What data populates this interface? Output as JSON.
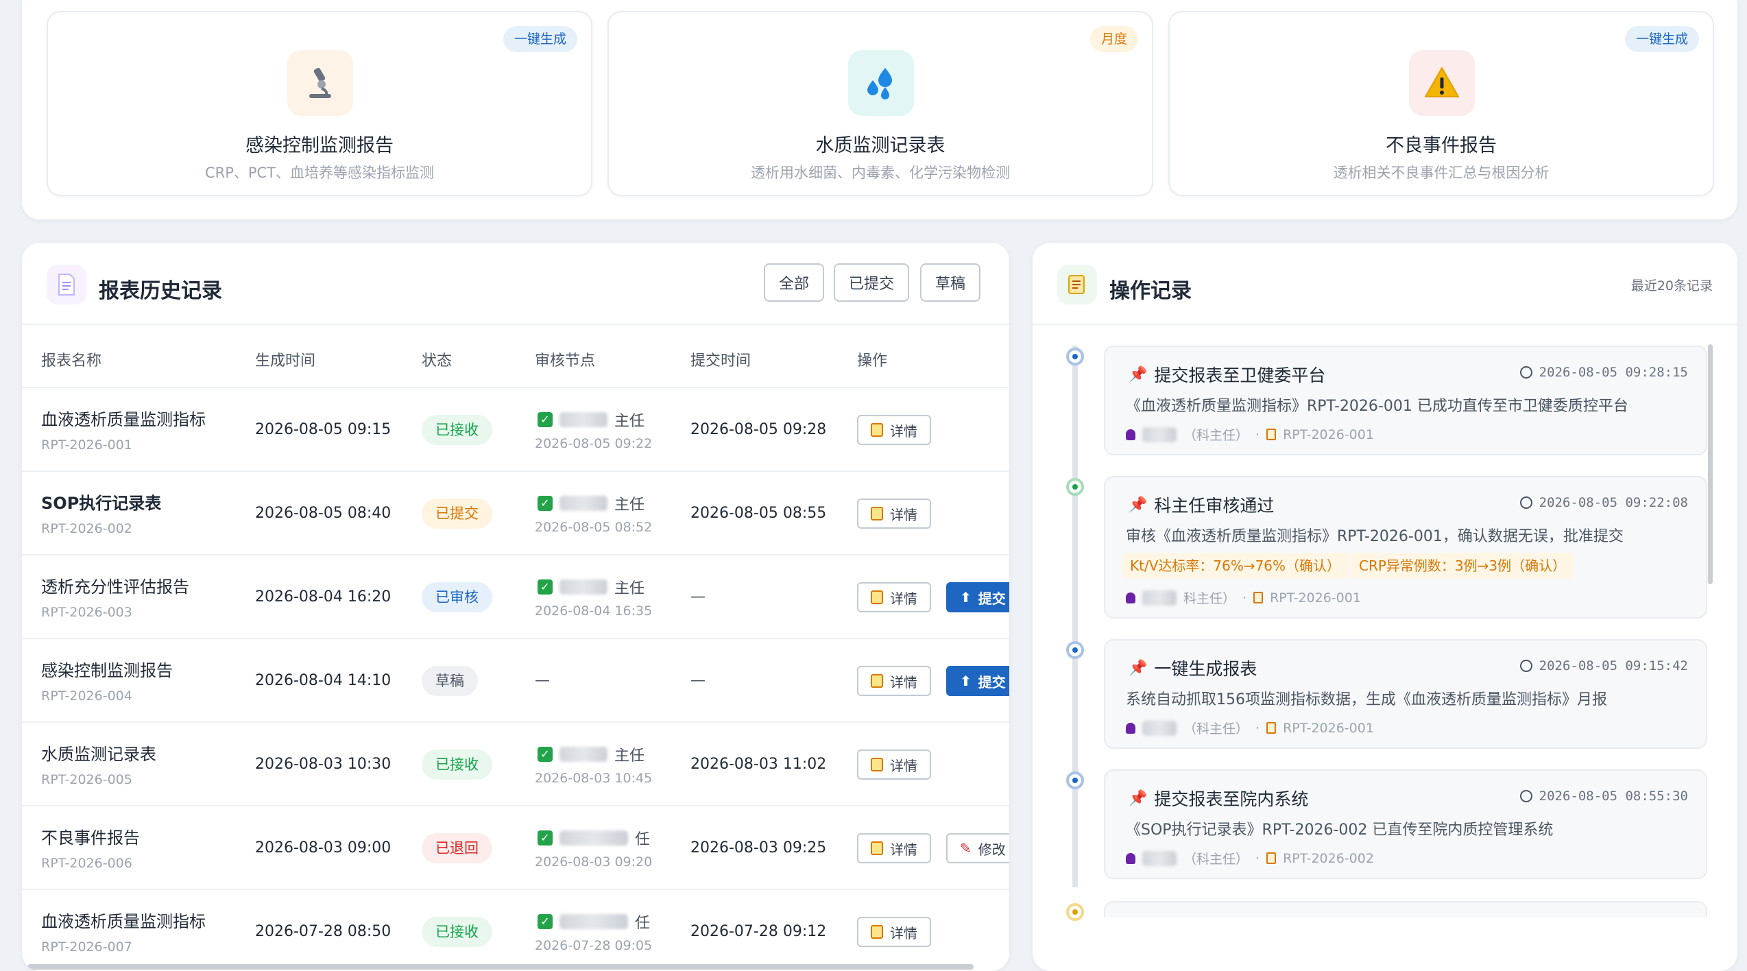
{
  "report_types": [
    {
      "badge": "一键生成",
      "title": "感染控制监测报告",
      "subtitle": "CRP、PCT、血培养等感染指标监测",
      "icon": "microscope-icon"
    },
    {
      "badge": "月度",
      "title": "水质监测记录表",
      "subtitle": "透析用水细菌、内毒素、化学污染物检测",
      "icon": "water-drops-icon"
    },
    {
      "badge": "一键生成",
      "title": "不良事件报告",
      "subtitle": "透析相关不良事件汇总与根因分析",
      "icon": "warning-icon"
    }
  ],
  "history": {
    "title": "报表历史记录",
    "filters": {
      "all": "全部",
      "submitted": "已提交",
      "draft": "草稿"
    },
    "columns": {
      "name": "报表名称",
      "gen_time": "生成时间",
      "status": "状态",
      "review": "审核节点",
      "submit_time": "提交时间",
      "action": "操作"
    },
    "actions": {
      "detail": "详情",
      "submit": "提交",
      "edit": "修改"
    },
    "rows": [
      {
        "name": "血液透析质量监测指标",
        "id": "RPT-2026-001",
        "gen_time": "2026-08-05 09:15",
        "status": "已接收",
        "reviewer": "主任",
        "review_time": "2026-08-05 09:22",
        "submit_time": "2026-08-05 09:28"
      },
      {
        "name": "SOP执行记录表",
        "id": "RPT-2026-002",
        "gen_time": "2026-08-05 08:40",
        "status": "已提交",
        "reviewer": "主任",
        "review_time": "2026-08-05 08:52",
        "submit_time": "2026-08-05 08:55"
      },
      {
        "name": "透析充分性评估报告",
        "id": "RPT-2026-003",
        "gen_time": "2026-08-04 16:20",
        "status": "已审核",
        "reviewer": "主任",
        "review_time": "2026-08-04 16:35",
        "submit_time": "—"
      },
      {
        "name": "感染控制监测报告",
        "id": "RPT-2026-004",
        "gen_time": "2026-08-04 14:10",
        "status": "草稿",
        "reviewer": "—",
        "review_time": "",
        "submit_time": "—"
      },
      {
        "name": "水质监测记录表",
        "id": "RPT-2026-005",
        "gen_time": "2026-08-03 10:30",
        "status": "已接收",
        "reviewer": "主任",
        "review_time": "2026-08-03 10:45",
        "submit_time": "2026-08-03 11:02"
      },
      {
        "name": "不良事件报告",
        "id": "RPT-2026-006",
        "gen_time": "2026-08-03 09:00",
        "status": "已退回",
        "reviewer": "任",
        "review_time": "2026-08-03 09:20",
        "submit_time": "2026-08-03 09:25"
      },
      {
        "name": "血液透析质量监测指标",
        "id": "RPT-2026-007",
        "gen_time": "2026-07-28 08:50",
        "status": "已接收",
        "reviewer": "任",
        "review_time": "2026-07-28 09:05",
        "submit_time": "2026-07-28 09:12"
      }
    ]
  },
  "oplog": {
    "title": "操作记录",
    "subtitle": "最近20条记录",
    "entries": [
      {
        "title": "提交报表至卫健委平台",
        "time": "2026-08-05 09:28:15",
        "desc": "《血液透析质量监测指标》RPT-2026-001 已成功直传至市卫健委质控平台",
        "role": "（科主任）",
        "ref": "RPT-2026-001"
      },
      {
        "title": "科主任审核通过",
        "time": "2026-08-05 09:22:08",
        "desc": "审核《血液透析质量监测指标》RPT-2026-001，确认数据无误，批准提交",
        "tag1": "Kt/V达标率：76%→76%（确认）",
        "tag2": "CRP异常例数：3例→3例（确认）",
        "role": "科主任）",
        "ref": "RPT-2026-001"
      },
      {
        "title": "一键生成报表",
        "time": "2026-08-05 09:15:42",
        "desc": "系统自动抓取156项监测指标数据，生成《血液透析质量监测指标》月报",
        "role": "（科主任）",
        "ref": "RPT-2026-001"
      },
      {
        "title": "提交报表至院内系统",
        "time": "2026-08-05 08:55:30",
        "desc": "《SOP执行记录表》RPT-2026-002 已直传至院内质控管理系统",
        "role": "（科主任）",
        "ref": "RPT-2026-002"
      }
    ]
  },
  "colors": {
    "primary": "#1d66c2",
    "accepted": "#16a34a",
    "submitted": "#d97706",
    "reviewed": "#1d66c2",
    "draft": "#4b5563",
    "returned": "#dc2626"
  }
}
